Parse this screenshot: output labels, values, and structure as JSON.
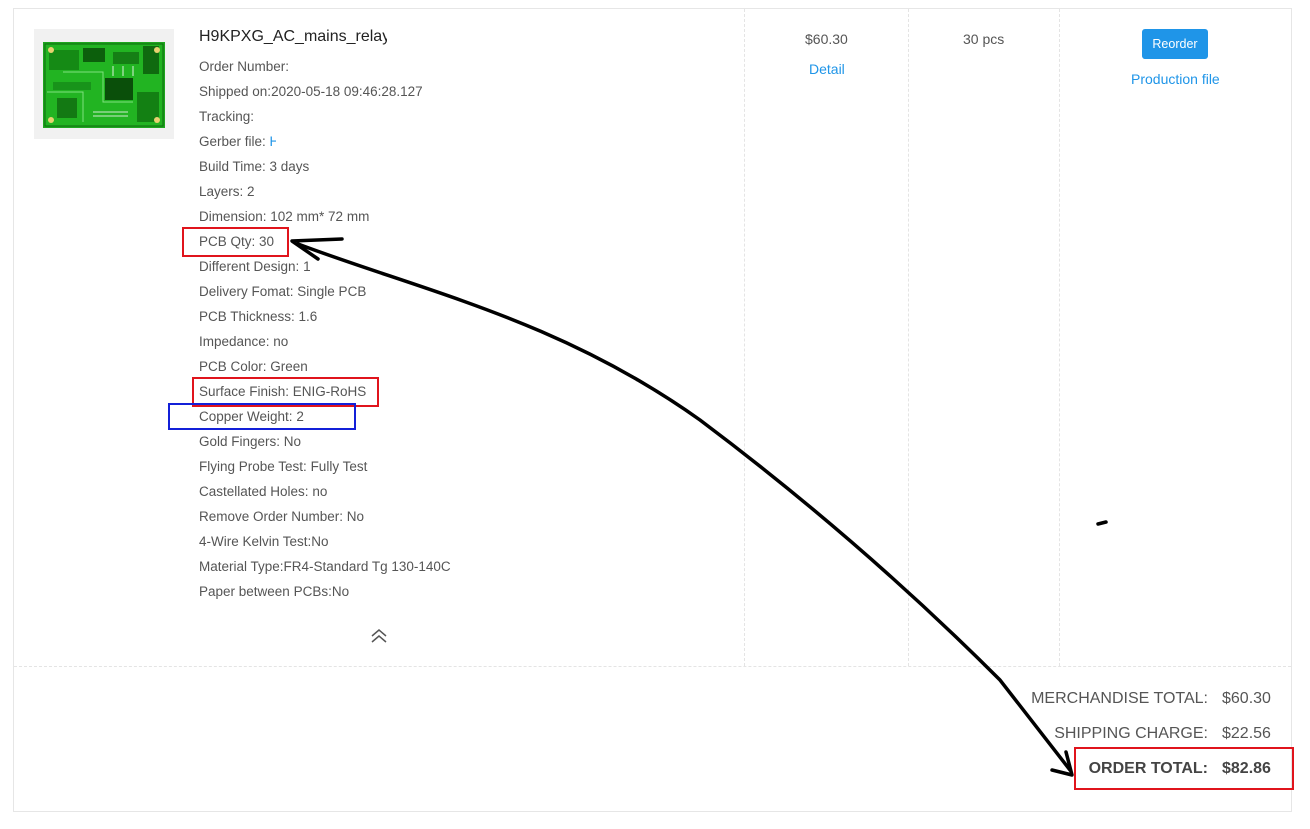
{
  "product": {
    "title": "H9KPXG_AC_mains_relay",
    "specs": [
      {
        "label": "Order Number:",
        "value": ""
      },
      {
        "label": "Shipped on:",
        "value": "2020-05-18 09:46:28.127"
      },
      {
        "label": "Tracking:",
        "value": ""
      },
      {
        "label": "Gerber file: ",
        "value": "",
        "link": "H"
      },
      {
        "label": "Build Time: ",
        "value": "3 days"
      },
      {
        "label": "Layers: ",
        "value": "2"
      },
      {
        "label": "Dimension: ",
        "value": "102 mm* 72 mm"
      },
      {
        "label": "PCB Qty: ",
        "value": "30"
      },
      {
        "label": "Different Design: ",
        "value": "1"
      },
      {
        "label": "Delivery Fomat: ",
        "value": "Single PCB"
      },
      {
        "label": "PCB Thickness: ",
        "value": "1.6"
      },
      {
        "label": "Impedance: ",
        "value": "no"
      },
      {
        "label": "PCB Color: ",
        "value": "Green"
      },
      {
        "label": "Surface Finish: ",
        "value": "ENIG-RoHS"
      },
      {
        "label": "Copper Weight: ",
        "value": "2"
      },
      {
        "label": "Gold Fingers: ",
        "value": "No"
      },
      {
        "label": "Flying Probe Test: ",
        "value": "Fully Test"
      },
      {
        "label": "Castellated Holes: ",
        "value": "no"
      },
      {
        "label": "Remove Order Number: ",
        "value": "No"
      },
      {
        "label": "4-Wire Kelvin Test:",
        "value": "No"
      },
      {
        "label": "Material Type:",
        "value": "FR4-Standard Tg 130-140C"
      },
      {
        "label": "Paper between PCBs:",
        "value": "No"
      }
    ],
    "thumbnail_icon": "pcb-board-image",
    "collapse_icon": "double-chevron-up-icon"
  },
  "price": {
    "amount": "$60.30",
    "detail_link": "Detail"
  },
  "quantity": "30 pcs",
  "actions": {
    "reorder_label": "Reorder",
    "production_file_label": "Production file"
  },
  "totals": [
    {
      "label": "MERCHANDISE TOTAL:",
      "value": "$60.30",
      "bold": false
    },
    {
      "label": "SHIPPING CHARGE:",
      "value": "$22.56",
      "bold": false
    },
    {
      "label": "ORDER TOTAL:",
      "value": "$82.86",
      "bold": true
    }
  ],
  "annotations": {
    "highlight_red": "#e0141c",
    "highlight_blue": "#1320d8",
    "arrow_color": "#000000"
  },
  "colors": {
    "link_blue": "#1f95e8",
    "text": "#555555",
    "border": "#e6e6e6"
  }
}
